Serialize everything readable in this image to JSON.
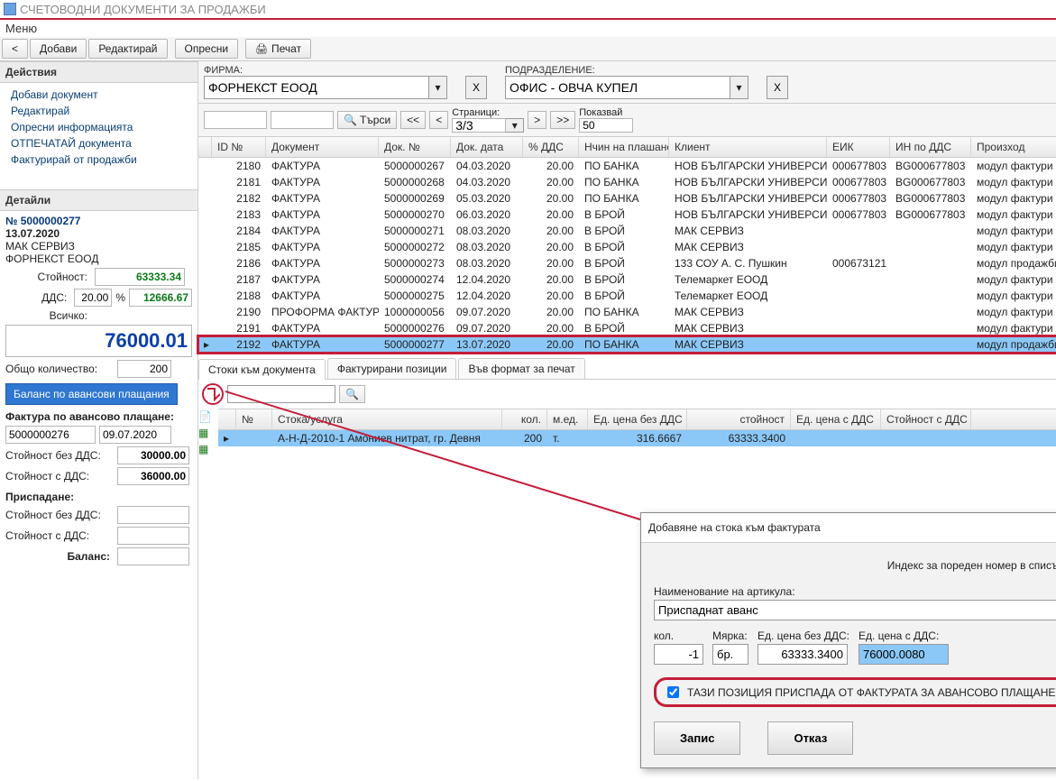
{
  "window": {
    "title": "СЧЕТОВОДНИ ДОКУМЕНТИ ЗА ПРОДАЖБИ",
    "menu": "Меню"
  },
  "toolbar": {
    "back": "<",
    "add": "Добави",
    "edit": "Редактирай",
    "refresh": "Опресни",
    "print": "Печат"
  },
  "icons": {
    "printer": "printer-icon",
    "add": "add-icon",
    "search": "search-icon"
  },
  "sidebar": {
    "actions_header": "Действия",
    "actions": [
      "Добави документ",
      "Редактирай",
      "Опресни информацията",
      "ОТПЕЧАТАЙ документа",
      "Фактурирай от продажби"
    ],
    "details_header": "Детайли",
    "doc_no_label": "№",
    "doc_no": "5000000277",
    "doc_date": "13.07.2020",
    "client": "МАК СЕРВИЗ",
    "company": "ФОРНЕКСТ ЕООД",
    "value_lbl": "Стойност:",
    "value": "63333.34",
    "vat_lbl": "ДДС:",
    "vat_pct": "20.00",
    "pct_sign": "%",
    "vat_val": "12666.67",
    "total_lbl": "Всичко:",
    "total": "76000.01",
    "qty_lbl": "Общо количество:",
    "qty": "200",
    "balance_btn": "Баланс по авансови плащания",
    "inv_label": "Фактура по авансово плащане:",
    "adv_doc": "5000000276",
    "adv_date": "09.07.2020",
    "val_ex_lbl": "Стойност без ДДС:",
    "val_ex": "30000.00",
    "val_inc_lbl": "Стойност с ДДС:",
    "val_inc": "36000.00",
    "deduct_lbl": "Приспадане:",
    "ded_ex_lbl": "Стойност без ДДС:",
    "ded_ex": "",
    "ded_inc_lbl": "Стойност с ДДС:",
    "ded_inc": "",
    "bal_lbl": "Баланс:",
    "bal": ""
  },
  "filter": {
    "company_lbl": "ФИРМА:",
    "company": "ФОРНЕКСТ ЕООД",
    "dept_lbl": "ПОДРАЗДЕЛЕНИЕ:",
    "dept": "ОФИС - ОВЧА КУПЕЛ",
    "clear": "X"
  },
  "search": {
    "search_lbl": "Търси",
    "first": "<<",
    "prev": "<",
    "next": ">",
    "last": ">>",
    "pages_lbl": "Страници:",
    "pages": "3/3",
    "show_lbl": "Показвай",
    "show": "50"
  },
  "grid": {
    "cols": [
      "ID №",
      "Документ",
      "Док. №",
      "Док. дата",
      "% ДДС",
      "Нчин на плашане",
      "Клиент",
      "ЕИК",
      "ИН по ДДС",
      "Произход"
    ],
    "rows": [
      {
        "id": "2180",
        "doc": "ФАКТУРА",
        "no": "5000000267",
        "date": "04.03.2020",
        "vat": "20.00",
        "pay": "ПО БАНКА",
        "cli": "НОВ БЪЛГАРСКИ УНИВЕРСИТЕТ",
        "eik": "000677803",
        "dds": "BG000677803",
        "src": "модул фактури"
      },
      {
        "id": "2181",
        "doc": "ФАКТУРА",
        "no": "5000000268",
        "date": "04.03.2020",
        "vat": "20.00",
        "pay": "ПО БАНКА",
        "cli": "НОВ БЪЛГАРСКИ УНИВЕРСИТЕТ",
        "eik": "000677803",
        "dds": "BG000677803",
        "src": "модул фактури"
      },
      {
        "id": "2182",
        "doc": "ФАКТУРА",
        "no": "5000000269",
        "date": "05.03.2020",
        "vat": "20.00",
        "pay": "ПО БАНКА",
        "cli": "НОВ БЪЛГАРСКИ УНИВЕРСИТЕТ",
        "eik": "000677803",
        "dds": "BG000677803",
        "src": "модул фактури"
      },
      {
        "id": "2183",
        "doc": "ФАКТУРА",
        "no": "5000000270",
        "date": "06.03.2020",
        "vat": "20.00",
        "pay": "В БРОЙ",
        "cli": "НОВ БЪЛГАРСКИ УНИВЕРСИТЕТ",
        "eik": "000677803",
        "dds": "BG000677803",
        "src": "модул фактури"
      },
      {
        "id": "2184",
        "doc": "ФАКТУРА",
        "no": "5000000271",
        "date": "08.03.2020",
        "vat": "20.00",
        "pay": "В БРОЙ",
        "cli": "МАК СЕРВИЗ",
        "eik": "",
        "dds": "",
        "src": "модул фактури"
      },
      {
        "id": "2185",
        "doc": "ФАКТУРА",
        "no": "5000000272",
        "date": "08.03.2020",
        "vat": "20.00",
        "pay": "В БРОЙ",
        "cli": "МАК СЕРВИЗ",
        "eik": "",
        "dds": "",
        "src": "модул фактури"
      },
      {
        "id": "2186",
        "doc": "ФАКТУРА",
        "no": "5000000273",
        "date": "08.03.2020",
        "vat": "20.00",
        "pay": "В БРОЙ",
        "cli": "133 СОУ А. С. Пушкин",
        "eik": "000673121",
        "dds": "",
        "src": "модул продажби"
      },
      {
        "id": "2187",
        "doc": "ФАКТУРА",
        "no": "5000000274",
        "date": "12.04.2020",
        "vat": "20.00",
        "pay": "В БРОЙ",
        "cli": "Телемаркет ЕООД",
        "eik": "",
        "dds": "",
        "src": "модул фактури"
      },
      {
        "id": "2188",
        "doc": "ФАКТУРА",
        "no": "5000000275",
        "date": "12.04.2020",
        "vat": "20.00",
        "pay": "В БРОЙ",
        "cli": "Телемаркет ЕООД",
        "eik": "",
        "dds": "",
        "src": "модул фактури"
      },
      {
        "id": "2190",
        "doc": "ПРОФОРМА ФАКТУРА",
        "no": "1000000056",
        "date": "09.07.2020",
        "vat": "20.00",
        "pay": "ПО БАНКА",
        "cli": "МАК СЕРВИЗ",
        "eik": "",
        "dds": "",
        "src": "модул фактури"
      },
      {
        "id": "2191",
        "doc": "ФАКТУРА",
        "no": "5000000276",
        "date": "09.07.2020",
        "vat": "20.00",
        "pay": "В БРОЙ",
        "cli": "МАК СЕРВИЗ",
        "eik": "",
        "dds": "",
        "src": "модул фактури"
      },
      {
        "id": "2192",
        "doc": "ФАКТУРА",
        "no": "5000000277",
        "date": "13.07.2020",
        "vat": "20.00",
        "pay": "ПО БАНКА",
        "cli": "МАК СЕРВИЗ",
        "eik": "",
        "dds": "",
        "src": "модул продажби",
        "selected": true
      }
    ]
  },
  "tabs": [
    "Стоки към документа",
    "Фактурирани позиции",
    "Във формат за печат"
  ],
  "items": {
    "cols": [
      "№",
      "Стока/услуга",
      "кол.",
      "м.ед.",
      "Ед. цена без ДДС",
      "стойност",
      "Ед. цена с ДДС",
      "Стойност с ДДС"
    ],
    "row": {
      "no": "",
      "name": "А-Н-Д-2010-1 Амониев нитрат, гр. Девня",
      "qty": "200",
      "me": "т.",
      "price": "316.6667",
      "val": "63333.3400",
      "pricev": "",
      "valv": ""
    }
  },
  "dialog": {
    "title": "Добавяне на стока към фактурата",
    "index_lbl": "Индекс за пореден номер в списъка:",
    "index": "",
    "name_lbl": "Наименование на артикула:",
    "name": "Приспаднат аванс",
    "qty_lbl": "кол.",
    "qty": "-1",
    "me_lbl": "Мярка:",
    "me": "бр.",
    "price_lbl": "Ед. цена без ДДС:",
    "price": "63333.3400",
    "pricev_lbl": "Ед. цена с ДДС:",
    "pricev": "76000.0080",
    "check": "ТАЗИ ПОЗИЦИЯ ПРИСПАДА ОТ ФАКТУРАТА ЗА АВАНСОВО ПЛАЩАНЕ",
    "save": "Запис",
    "cancel": "Отказ"
  }
}
